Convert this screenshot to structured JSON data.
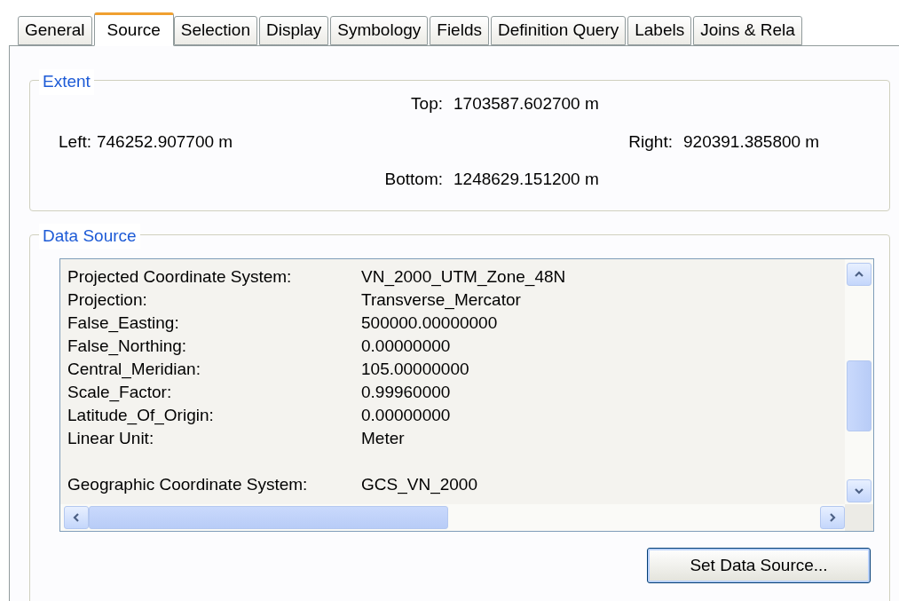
{
  "tabs": [
    {
      "label": "General",
      "selected": false
    },
    {
      "label": "Source",
      "selected": true
    },
    {
      "label": "Selection",
      "selected": false
    },
    {
      "label": "Display",
      "selected": false
    },
    {
      "label": "Symbology",
      "selected": false
    },
    {
      "label": "Fields",
      "selected": false
    },
    {
      "label": "Definition Query",
      "selected": false
    },
    {
      "label": "Labels",
      "selected": false
    },
    {
      "label": "Joins & Rela",
      "selected": false
    }
  ],
  "extent": {
    "title": "Extent",
    "top_label": "Top:",
    "top": "1703587.602700 m",
    "left_label": "Left:",
    "left": "746252.907700 m",
    "right_label": "Right:",
    "right": "920391.385800 m",
    "bottom_label": "Bottom:",
    "bottom": "1248629.151200 m"
  },
  "data_source": {
    "title": "Data Source",
    "row_groups": [
      [
        {
          "label": "Projected Coordinate System:",
          "value": "VN_2000_UTM_Zone_48N"
        },
        {
          "label": "Projection:",
          "value": "Transverse_Mercator"
        },
        {
          "label": "False_Easting:",
          "value": "500000.00000000"
        },
        {
          "label": "False_Northing:",
          "value": "0.00000000"
        },
        {
          "label": "Central_Meridian:",
          "value": "105.00000000"
        },
        {
          "label": "Scale_Factor:",
          "value": "0.99960000"
        },
        {
          "label": "Latitude_Of_Origin:",
          "value": "0.00000000"
        },
        {
          "label": "Linear Unit:",
          "value": "Meter"
        }
      ],
      [
        {
          "label": "Geographic Coordinate System:",
          "value": "GCS_VN_2000"
        }
      ]
    ],
    "button": "Set Data Source..."
  }
}
